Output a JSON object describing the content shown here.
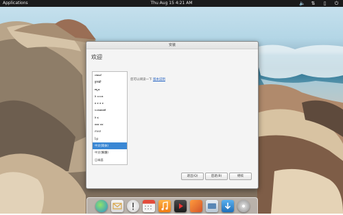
{
  "panel": {
    "applications_label": "Applications",
    "clock": "Thu Aug 15   4:21 AM"
  },
  "window": {
    "title": "安装",
    "welcome": "欢迎",
    "hint_text": "您可以阅读一下",
    "hint_link": "版本说明",
    "languages": [
      "ಚವಾಣಿ",
      "ਕੁਲਫ਼ੀ",
      "ಕನ್ನಡ",
      "ಠಿ ಎಂಬಾ",
      "ಠ ಠ ಠ ಠ",
      "ಉದಾಹರಣೆ",
      "ಠಿ ಠ಼",
      "ಠಠಠ ಠಠ",
      "ភាសា",
      "ខ្មែរ",
      "中文(简体)",
      "中文(繁體)",
      "日本語"
    ],
    "selected_language_index": 10,
    "buttons": {
      "quit": "退出(Q)",
      "back": "后退(B)",
      "continue": "继续"
    }
  },
  "dock": {
    "icons": [
      "midori-icon",
      "mail-icon",
      "notification-icon",
      "calendar-icon",
      "music-icon",
      "video-icon",
      "photos-icon",
      "system-settings-icon",
      "app-center-icon",
      "installer-icon"
    ]
  },
  "colors": {
    "selection": "#3a87d4",
    "link": "#2a66c4",
    "panel": "#1b1b1b"
  }
}
